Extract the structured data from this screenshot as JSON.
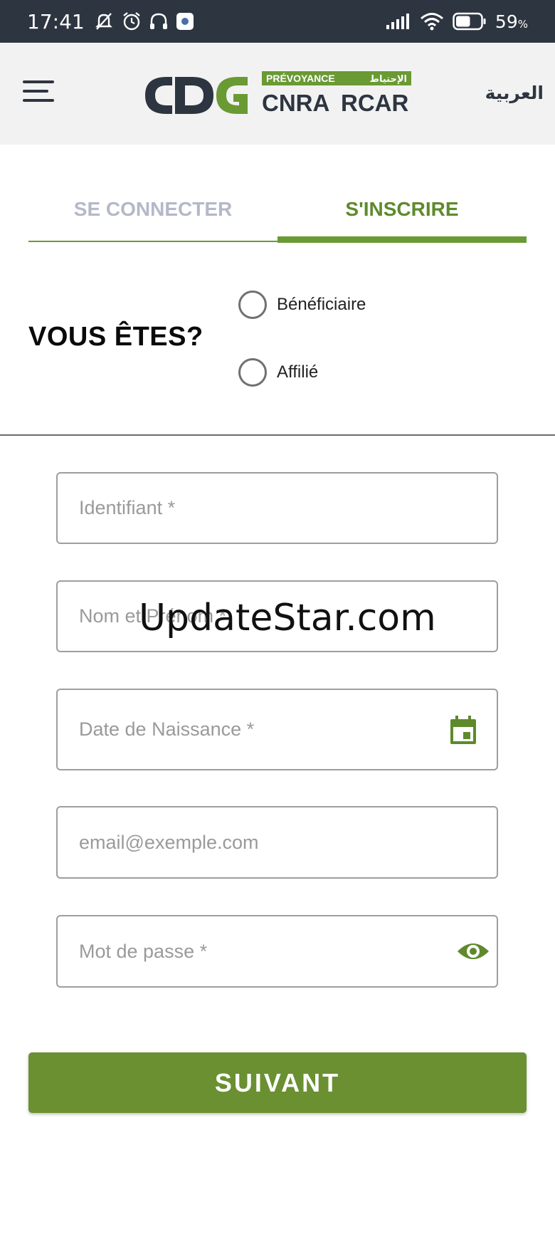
{
  "status_bar": {
    "time": "17:41",
    "battery_percent": "59",
    "battery_unit": "%",
    "battery_level": 0.59,
    "left_icons": [
      "muted-notifications-icon",
      "alarm-icon",
      "headset-icon",
      "app-notification-icon"
    ],
    "right_icons": [
      "signal-icon",
      "wifi-icon",
      "battery-icon"
    ]
  },
  "header": {
    "logo": {
      "mark": "CDG",
      "tag_fr": "PRÉVOYANCE",
      "tag_ar": "الإحتياط",
      "brand_left": "CNRA",
      "brand_right": "RCAR"
    },
    "language_link": "العربية",
    "menu_icon": "hamburger-menu-icon"
  },
  "tabs": [
    {
      "label": "SE CONNECTER",
      "active": false
    },
    {
      "label": "S'INSCRIRE",
      "active": true
    }
  ],
  "user_type": {
    "label": "VOUS ÊTES?",
    "options": [
      {
        "label": "Bénéficiaire",
        "selected": false
      },
      {
        "label": "Affilié",
        "selected": false
      }
    ]
  },
  "form": {
    "identifier": {
      "value": "",
      "placeholder": "Identifiant *"
    },
    "full_name": {
      "value": "",
      "placeholder": "Nom et Prénom *"
    },
    "birth_date": {
      "value": "",
      "placeholder": "Date de Naissance *",
      "icon": "calendar-icon"
    },
    "email": {
      "value": "",
      "placeholder": "email@exemple.com"
    },
    "password": {
      "value": "",
      "placeholder": "Mot de passe *",
      "icon": "eye-icon"
    },
    "submit_label": "SUIVANT"
  },
  "watermark": "UpdateStar.com",
  "colors": {
    "status_bar_bg": "#2d3540",
    "header_bg": "#f2f2f2",
    "brand_green": "#6a9a33",
    "brand_dark": "#2d3540",
    "button_green": "#6a9032",
    "inactive_tab": "#b4b8c8"
  }
}
